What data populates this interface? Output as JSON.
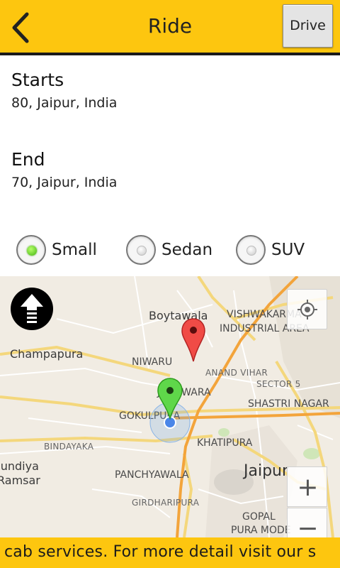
{
  "header": {
    "title": "Ride",
    "drive_label": "Drive",
    "accent": "#FDC60F"
  },
  "start": {
    "label": "Starts",
    "value": "80, Jaipur, India"
  },
  "end": {
    "label": "End",
    "value": "70, Jaipur, India"
  },
  "vehicle_types": [
    {
      "label": "Small",
      "selected": true
    },
    {
      "label": "Sedan",
      "selected": false
    },
    {
      "label": "SUV",
      "selected": false
    }
  ],
  "map": {
    "labels": {
      "boytawala": "Boytawala",
      "vishwakarma": "VISHWAKARMA",
      "industrial": "INDUSTRIAL AREA",
      "champapura": "Champapura",
      "niwaru": "NIWARU",
      "anand_vihar": "ANAND VIHAR",
      "sector5": "SECTOR 5",
      "jhotwara": "JHOTWARA",
      "gokulpura": "GOKULPURA",
      "shastri_nagar": "SHASTRI NAGAR",
      "khatipura": "KHATIPURA",
      "bindayaka": "BINDAYAKA",
      "jundiya": "Jundiya",
      "ramsar": "Ramsar",
      "panchyawala": "PANCHYAWALA",
      "jaipur": "Jaipur",
      "girdharipura": "GIRDHARIPURA",
      "gopal": "GOPAL",
      "pura_mode": "PURA MODE"
    },
    "zoom_in": "+",
    "zoom_out": "−",
    "icons": {
      "navigation": "navigation-arrow-icon",
      "my_location": "crosshair-icon",
      "destination_marker": "red-map-pin-icon",
      "origin_marker": "green-map-pin-icon",
      "current_location": "blue-dot-icon"
    }
  },
  "ticker": {
    "text": "cab services. For more detail visit our s"
  }
}
